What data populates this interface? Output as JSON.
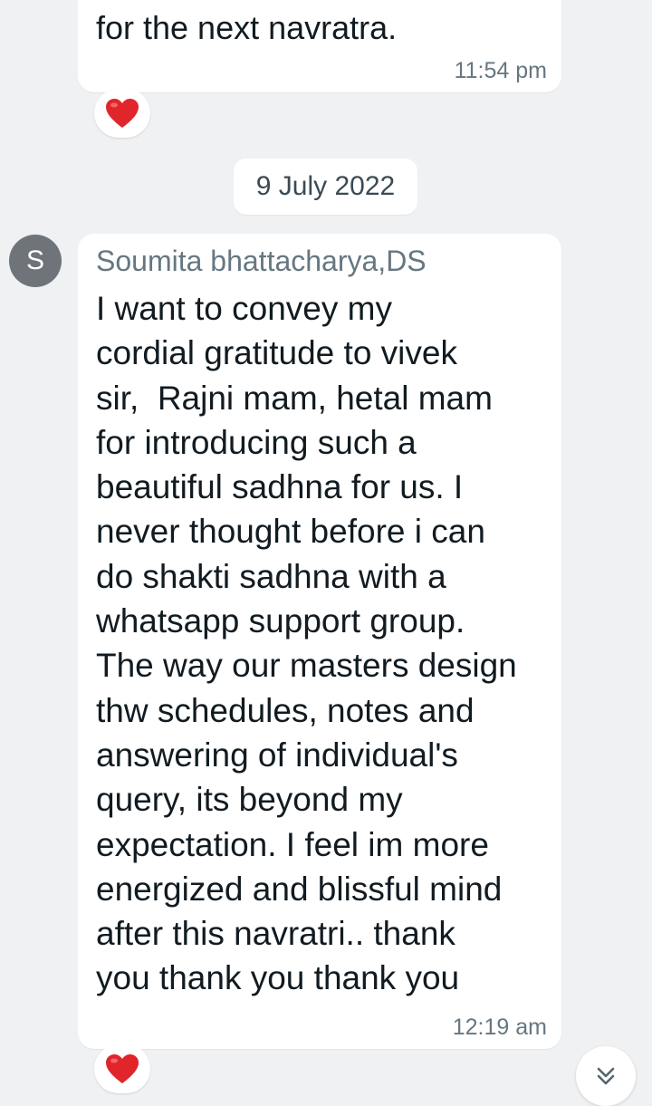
{
  "previous_message": {
    "text": "for the next navratra.",
    "time": "11:54 pm",
    "reaction": "❤️"
  },
  "date_separator": "9 July 2022",
  "message": {
    "avatar_initial": "S",
    "sender": "Soumita bhattacharya,DS",
    "lines": [
      "I want to convey my",
      "cordial gratitude to vivek",
      "sir,  Rajni mam, hetal mam",
      "for introducing such a",
      "beautiful sadhna for us. I",
      "never thought before i can",
      "do shakti sadhna with a",
      "whatsapp support group.",
      "The way our masters design",
      "thw schedules, notes and",
      "answering of individual's",
      "query, its beyond my",
      "expectation. I feel im more",
      "energized and blissful mind",
      "after this navratri.. thank",
      "you thank you thank you"
    ],
    "time": "12:19 am",
    "reaction": "❤️"
  },
  "icons": {
    "reaction_icon": "heart-icon",
    "scroll_icon": "double-chevron-down-icon"
  },
  "colors": {
    "background": "#eff1f3",
    "bubble": "#ffffff",
    "heart": "#e0262b",
    "avatar": "#6e7479",
    "timestamp": "#667781"
  }
}
